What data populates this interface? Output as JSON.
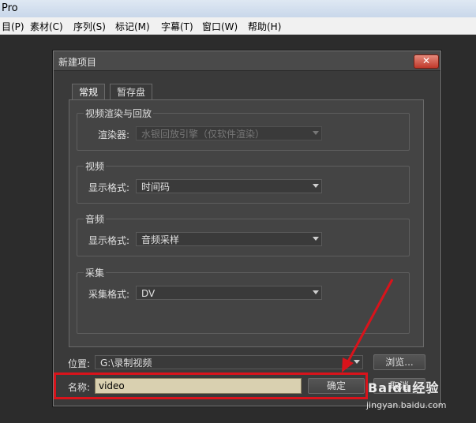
{
  "app": {
    "title": "Pro"
  },
  "menu": {
    "items": [
      "目(P)",
      "素材(C)",
      "序列(S)",
      "标记(M)",
      "字幕(T)",
      "窗口(W)",
      "帮助(H)"
    ]
  },
  "dialog": {
    "title": "新建项目",
    "close": "✕",
    "tabs": [
      "常规",
      "暂存盘"
    ],
    "video_render": {
      "group": "视频渲染与回放",
      "label": "渲染器:",
      "value": "水银回放引擎（仅软件渲染）"
    },
    "video": {
      "group": "视频",
      "label": "显示格式:",
      "value": "时间码"
    },
    "audio": {
      "group": "音频",
      "label": "显示格式:",
      "value": "音频采样"
    },
    "capture": {
      "group": "采集",
      "label": "采集格式:",
      "value": "DV"
    },
    "location": {
      "label": "位置:",
      "value": "G:\\录制视频",
      "browse": "浏览..."
    },
    "name": {
      "label": "名称:",
      "value": "video"
    },
    "ok": "确定",
    "cancel": "取消"
  },
  "annotation": {
    "color": "#d9131b"
  },
  "watermark": {
    "brand": "Baidu经验",
    "url": "jingyan.baidu.com"
  }
}
